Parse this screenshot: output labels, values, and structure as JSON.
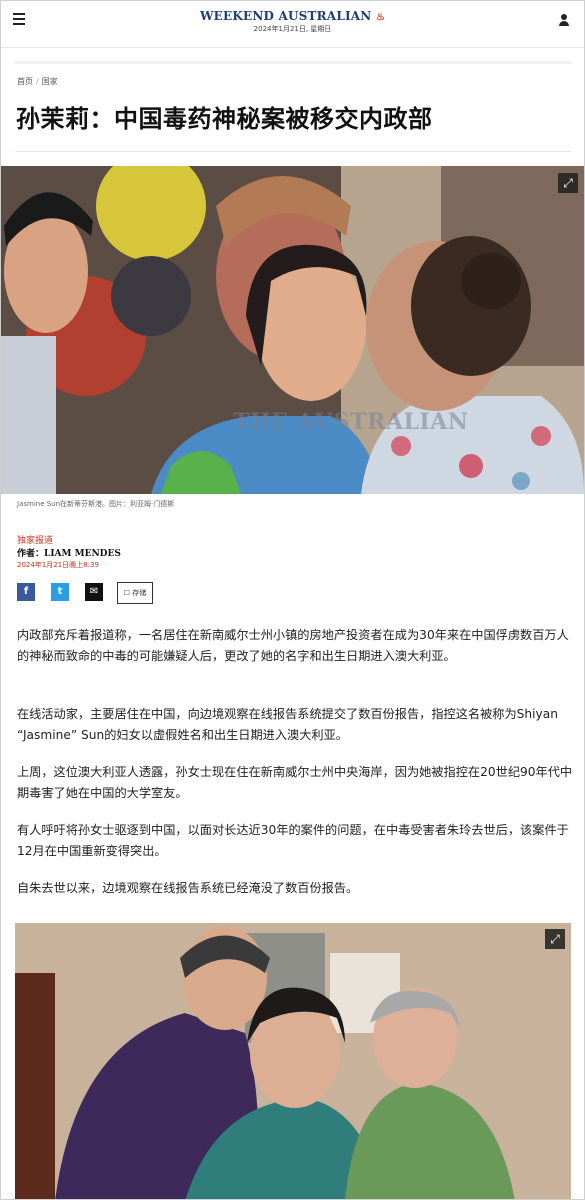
{
  "header": {
    "logo": "WEEKEND AUSTRALIAN",
    "date": "2024年1月21日, 星期日"
  },
  "breadcrumb": {
    "home": "首页",
    "section": "国家"
  },
  "headline": "孙茉莉：中国毒药神秘案被移交内政部",
  "hero": {
    "watermark": "THE AUSTRALIAN",
    "caption": "Jasmine Sun在新蒂芬斯港。图片：利亚姆·门德斯"
  },
  "byline": {
    "tag": "独家报道",
    "author_prefix": "作者：",
    "author_name": "LIAM MENDES",
    "published": "2024年1月21日晚上8:39"
  },
  "share": {
    "facebook": "f",
    "twitter": "t",
    "email": "✉",
    "save_label": "存储"
  },
  "article": {
    "p1": "内政部充斥着报道称，一名居住在新南威尔士州小镇的房地产投资者在成为30年来在中国俘虏数百万人的神秘而致命的中毒的可能嫌疑人后，更改了她的名字和出生日期进入澳大利亚。",
    "p2": "在线活动家，主要居住在中国，向边境观察在线报告系统提交了数百份报告，指控这名被称为Shiyan “Jasmine” Sun的妇女以虚假姓名和出生日期进入澳大利亚。",
    "p3": "上周，这位澳大利亚人透露，孙女士现在住在新南威尔士州中央海岸，因为她被指控在20世纪90年代中期毒害了她在中国的大学室友。",
    "p4": "有人呼吁将孙女士驱逐到中国，以面对长达近30年的案件的问题，在中毒受害者朱玲去世后，该案件于12月在中国重新变得突出。",
    "p5": "自朱去世以来，边境观察在线报告系统已经淹没了数百份报告。"
  },
  "colors": {
    "accent": "#c4361d",
    "brand": "#1d3f73",
    "facebook": "#3b5a9b",
    "twitter": "#2a9fe2"
  }
}
